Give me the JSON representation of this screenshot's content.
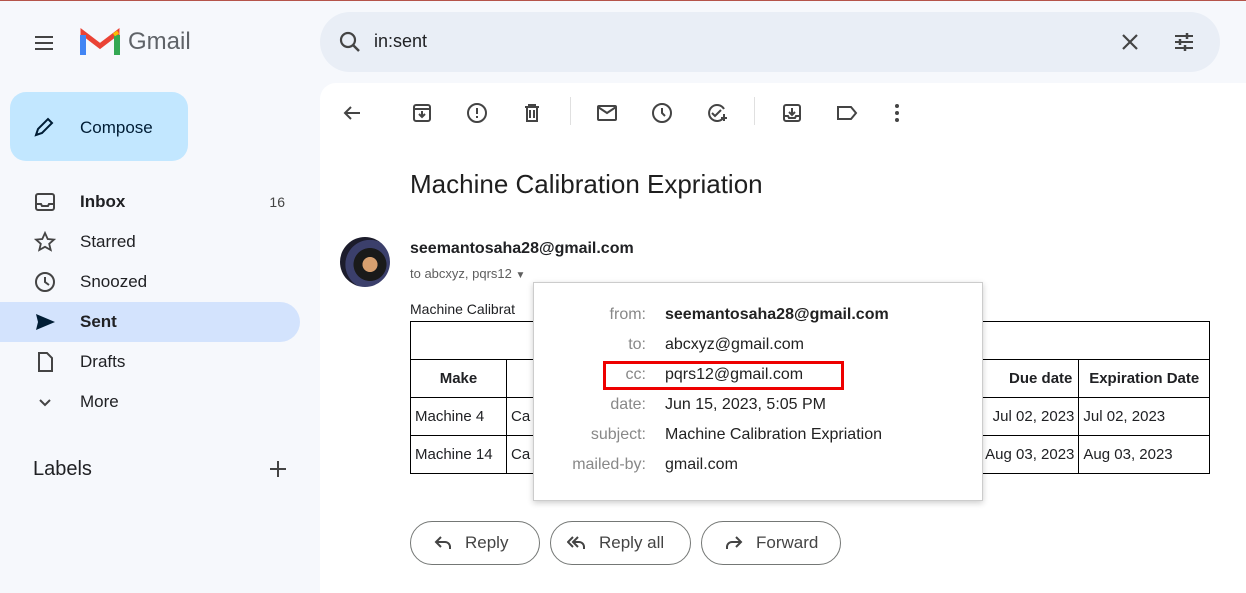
{
  "app": {
    "name": "Gmail"
  },
  "search": {
    "query": "in:sent"
  },
  "compose": {
    "label": "Compose"
  },
  "sidebar": {
    "items": [
      {
        "label": "Inbox",
        "count": "16",
        "icon": "inbox-icon"
      },
      {
        "label": "Starred",
        "icon": "star-icon"
      },
      {
        "label": "Snoozed",
        "icon": "clock-icon"
      },
      {
        "label": "Sent",
        "icon": "send-icon"
      },
      {
        "label": "Drafts",
        "icon": "file-icon"
      },
      {
        "label": "More",
        "icon": "chevron-down-icon"
      }
    ],
    "labels_title": "Labels"
  },
  "email": {
    "subject": "Machine Calibration Expriation",
    "sender": "seemantosaha28@gmail.com",
    "to_summary": "to abcxyz, pqrs12",
    "body_intro": "Machine Calibrat",
    "table": {
      "headers": [
        "Make",
        "",
        "Due date",
        "Expiration Date"
      ],
      "rows": [
        [
          "Machine 4",
          "Ca",
          "Jul 02, 2023",
          "Jul 02, 2023"
        ],
        [
          "Machine 14",
          "Ca",
          "Aug 03, 2023",
          "Aug 03, 2023"
        ]
      ]
    }
  },
  "details": {
    "from_label": "from:",
    "from": "seemantosaha28@gmail.com",
    "to_label": "to:",
    "to": "abcxyz@gmail.com",
    "cc_label": "cc:",
    "cc": "pqrs12@gmail.com",
    "date_label": "date:",
    "date": "Jun 15, 2023, 5:05 PM",
    "subject_label": "subject:",
    "subject": "Machine Calibration Expriation",
    "mailedby_label": "mailed-by:",
    "mailedby": "gmail.com"
  },
  "actions": {
    "reply": "Reply",
    "reply_all": "Reply all",
    "forward": "Forward"
  },
  "colors": {
    "highlight": "#e00000",
    "compose_bg": "#c2e7ff",
    "active_nav": "#d3e3fd"
  }
}
